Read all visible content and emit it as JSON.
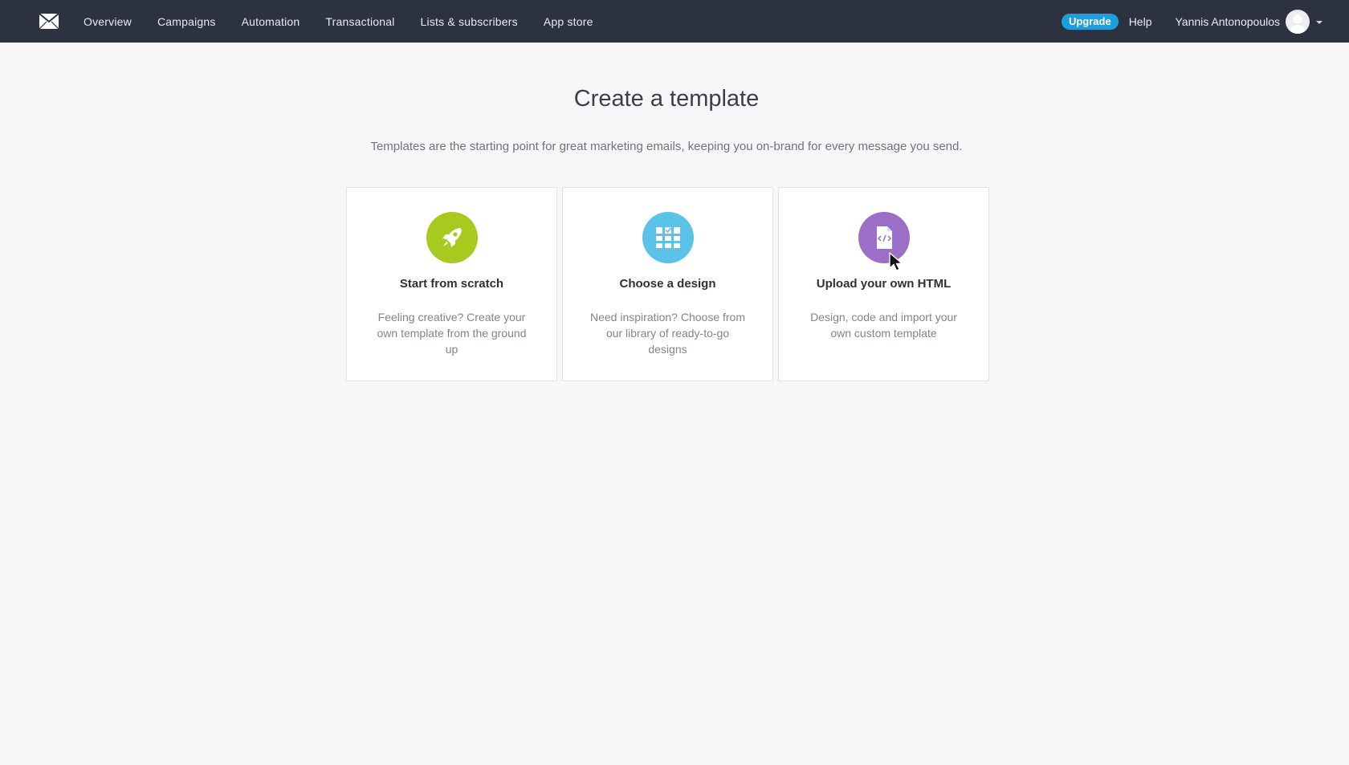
{
  "nav": {
    "logo": "mail-logo-icon",
    "items": [
      {
        "label": "Overview"
      },
      {
        "label": "Campaigns"
      },
      {
        "label": "Automation"
      },
      {
        "label": "Transactional"
      },
      {
        "label": "Lists & subscribers"
      },
      {
        "label": "App store"
      }
    ]
  },
  "account": {
    "upgrade_label": "Upgrade",
    "help_label": "Help",
    "user_name": "Yannis Antonopoulos"
  },
  "page": {
    "title": "Create a template",
    "subtitle": "Templates are the starting point for great marketing emails, keeping you on-brand for every message you send."
  },
  "cards": [
    {
      "title": "Start from scratch",
      "description": "Feeling creative? Create your own template from the ground up",
      "icon": "rocket-icon",
      "color": "#a8c91d"
    },
    {
      "title": "Choose a design",
      "description": "Need inspiration? Choose from our library of ready-to-go designs",
      "icon": "design-grid-icon",
      "color": "#5cc3e8"
    },
    {
      "title": "Upload your own HTML",
      "description": "Design, code and import your own custom template",
      "icon": "html-file-icon",
      "color": "#9b6fc7"
    }
  ],
  "colors": {
    "topbar": "#2d3240",
    "upgrade": "#1aa0de",
    "background": "#f7f7f9"
  }
}
